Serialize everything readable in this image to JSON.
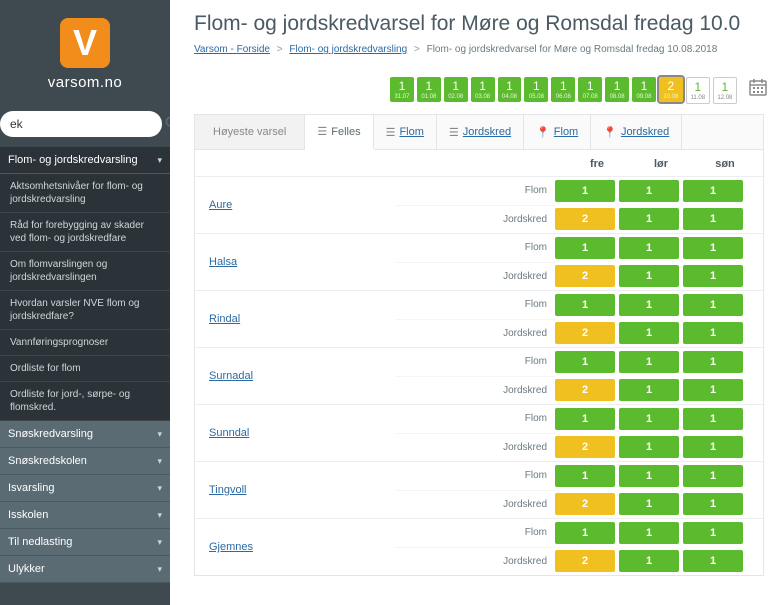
{
  "logo_letter": "V",
  "site_name": "varsom.no",
  "search_placeholder": "ek",
  "sidebar": {
    "active_head": "Flom- og jordskredvarsling",
    "subitems": [
      "Aktsomhetsnivåer for flom- og jordskredvarsling",
      "Råd for forebygging av skader ved flom- og jordskredfare",
      "Om flomvarslingen og jordskredvarslingen",
      "Hvordan varsler NVE flom og jordskredfare?",
      "Vannføringsprognoser",
      "Ordliste for flom",
      "Ordliste for jord-, sørpe- og flomskred."
    ],
    "other_heads": [
      "Snøskredvarsling",
      "Snøskredskolen",
      "Isvarsling",
      "Isskolen",
      "Til nedlasting",
      "Ulykker"
    ]
  },
  "title": "Flom- og jordskredvarsel for Møre og Romsdal fredag 10.0",
  "breadcrumb": {
    "a1": "Varsom - Forside",
    "a2": "Flom- og jordskredvarsling",
    "current": "Flom- og jordskredvarsel for Møre og Romsdal fredag 10.08.2018"
  },
  "dates": [
    {
      "n": "1",
      "d": "31.07"
    },
    {
      "n": "1",
      "d": "01.08"
    },
    {
      "n": "1",
      "d": "02.08"
    },
    {
      "n": "1",
      "d": "03.08"
    },
    {
      "n": "1",
      "d": "04.08"
    },
    {
      "n": "1",
      "d": "05.08"
    },
    {
      "n": "1",
      "d": "06.08"
    },
    {
      "n": "1",
      "d": "07.08"
    },
    {
      "n": "1",
      "d": "08.08"
    },
    {
      "n": "1",
      "d": "09.08"
    },
    {
      "n": "2",
      "d": "10.08"
    },
    {
      "n": "1",
      "d": "11.08"
    },
    {
      "n": "1",
      "d": "12.08"
    }
  ],
  "datestrip_selected_index": 10,
  "datestrip_white_indices": [
    11,
    12
  ],
  "tabs": {
    "title": "Høyeste varsel",
    "felles": "Felles",
    "flom1": "Flom",
    "jord1": "Jordskred",
    "flom2": "Flom",
    "jord2": "Jordskred"
  },
  "day_headers": [
    "fre",
    "lør",
    "søn"
  ],
  "type_labels": {
    "flom": "Flom",
    "jord": "Jordskred"
  },
  "rows": [
    {
      "name": "Aure",
      "flom": [
        1,
        1,
        1
      ],
      "jord": [
        2,
        1,
        1
      ]
    },
    {
      "name": "Halsa",
      "flom": [
        1,
        1,
        1
      ],
      "jord": [
        2,
        1,
        1
      ]
    },
    {
      "name": "Rindal",
      "flom": [
        1,
        1,
        1
      ],
      "jord": [
        2,
        1,
        1
      ]
    },
    {
      "name": "Surnadal",
      "flom": [
        1,
        1,
        1
      ],
      "jord": [
        2,
        1,
        1
      ]
    },
    {
      "name": "Sunndal",
      "flom": [
        1,
        1,
        1
      ],
      "jord": [
        2,
        1,
        1
      ]
    },
    {
      "name": "Tingvoll",
      "flom": [
        1,
        1,
        1
      ],
      "jord": [
        2,
        1,
        1
      ]
    },
    {
      "name": "Gjemnes",
      "flom": [
        1,
        1,
        1
      ],
      "jord": [
        2,
        1,
        1
      ]
    }
  ]
}
